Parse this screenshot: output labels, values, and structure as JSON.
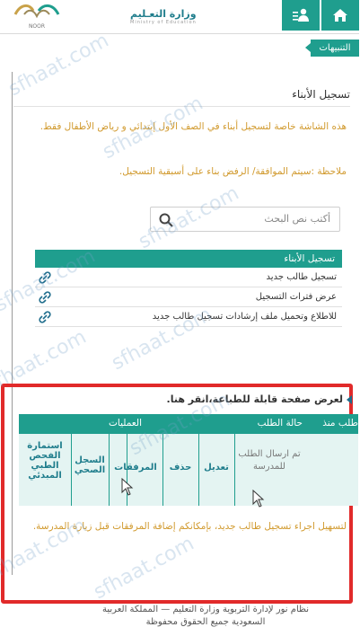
{
  "header": {
    "ministry_title": "وزارة التعـليم",
    "ministry_subtitle": "Ministry of Education",
    "noor_label": "NOOR",
    "home_icon": "home-icon",
    "users_icon": "users-icon"
  },
  "notice_tab": {
    "label": "التنبيهات"
  },
  "section": {
    "title": "تسجيل الأبناء",
    "description": "هذه الشاشة خاصة لتسجيل أبناء في الصف الأول إبتدائي و رياض الأطفال فقط.",
    "note": "ملاحظة :سيتم الموافقة/ الرفض بناء على أسبقية التسجيل."
  },
  "search": {
    "placeholder": "أكتب نص البحث"
  },
  "registration_table": {
    "header": "تسجيل الأبناء",
    "items": [
      {
        "label": "تسجيل طالب جديد"
      },
      {
        "label": "عرض فترات التسجيل"
      },
      {
        "label": "للاطلاع وتحميل ملف إرشادات تسجيل طالب جديد"
      }
    ]
  },
  "print_link": {
    "label": "لعرض صفحة قابلة للطباعة،انقر هنا."
  },
  "requests_table": {
    "col_request_since": "طلب منذ",
    "col_status": "حالة الطلب",
    "col_operations": "العمليات",
    "status_value": "تم ارسال الطلب للمدرسة",
    "operations": [
      "تعديل",
      "حذف",
      "المرفقات",
      "السجل الصحي",
      "استمارة الفحص الطبي المبدئي"
    ]
  },
  "footer_note": "لتسهيل اجراء تسجيل طالب جديد، بإمكانكم إضافة المرفقات قبل زيارة المدرسة.",
  "footer": {
    "line1": "نظام نور لإدارة التربوية وزارة التعليم — المملكة العربية",
    "line2": "السعودية جميع الحقوق محفوظة"
  },
  "watermark": "sfhaat.com",
  "colors": {
    "accent": "#1f9e8e",
    "highlight": "#e12a2a",
    "note_text": "#d19a2e"
  }
}
